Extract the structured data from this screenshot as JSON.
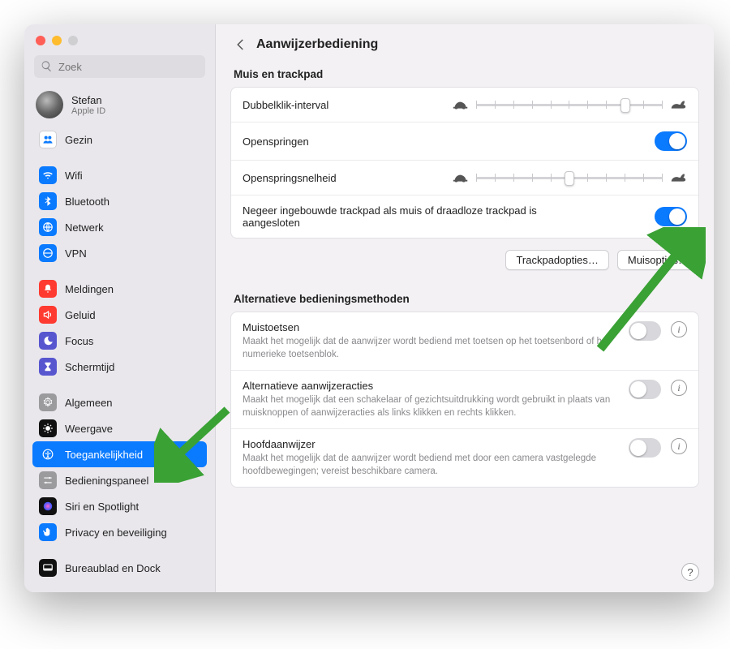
{
  "colors": {
    "accent": "#0a7aff",
    "arrow": "#3aa135"
  },
  "window": {
    "search_placeholder": "Zoek"
  },
  "profile": {
    "name": "Stefan",
    "sub": "Apple ID"
  },
  "sidebar": {
    "items": [
      {
        "label": "Gezin",
        "icon": "family-icon",
        "bg": "#ffffff",
        "fg": "#0a7aff",
        "border": true
      },
      {
        "sep": true
      },
      {
        "label": "Wifi",
        "icon": "wifi-icon",
        "bg": "#0a7aff"
      },
      {
        "label": "Bluetooth",
        "icon": "bluetooth-icon",
        "bg": "#0a7aff"
      },
      {
        "label": "Netwerk",
        "icon": "network-icon",
        "bg": "#0a7aff"
      },
      {
        "label": "VPN",
        "icon": "vpn-icon",
        "bg": "#0a7aff"
      },
      {
        "sep": true
      },
      {
        "label": "Meldingen",
        "icon": "bell-icon",
        "bg": "#ff3a30"
      },
      {
        "label": "Geluid",
        "icon": "sound-icon",
        "bg": "#ff3a30"
      },
      {
        "label": "Focus",
        "icon": "moon-icon",
        "bg": "#5856cf"
      },
      {
        "label": "Schermtijd",
        "icon": "hourglass-icon",
        "bg": "#5856cf"
      },
      {
        "sep": true
      },
      {
        "label": "Algemeen",
        "icon": "gear-icon",
        "bg": "#9b9b9e"
      },
      {
        "label": "Weergave",
        "icon": "display-icon",
        "bg": "#111111"
      },
      {
        "label": "Toegankelijkheid",
        "icon": "accessibility-icon",
        "bg": "#0a7aff",
        "selected": true
      },
      {
        "label": "Bedieningspaneel",
        "icon": "controls-icon",
        "bg": "#9b9b9e"
      },
      {
        "label": "Siri en Spotlight",
        "icon": "siri-icon",
        "bg": "#111111"
      },
      {
        "label": "Privacy en beveiliging",
        "icon": "hand-icon",
        "bg": "#0a7aff"
      },
      {
        "sep": true
      },
      {
        "label": "Bureaublad en Dock",
        "icon": "dock-icon",
        "bg": "#111111"
      }
    ]
  },
  "header": {
    "title": "Aanwijzerbediening"
  },
  "section1": {
    "title": "Muis en trackpad",
    "row_doubleclick": {
      "label": "Dubbelklik-interval",
      "value_percent": 80
    },
    "row_springload": {
      "label": "Openspringen",
      "on": true
    },
    "row_springspeed": {
      "label": "Openspringsnelheid",
      "value_percent": 50
    },
    "row_ignore": {
      "label": "Negeer ingebouwde trackpad als muis of draadloze trackpad is aangesloten",
      "on": true
    },
    "button_trackpad": "Trackpadopties…",
    "button_mouse": "Muisopties…"
  },
  "section2": {
    "title": "Alternatieve bedieningsmethoden",
    "rows": [
      {
        "title": "Muistoetsen",
        "desc": "Maakt het mogelijk dat de aanwijzer wordt bediend met toetsen op het toetsenbord of het numerieke toetsenblok.",
        "on": false
      },
      {
        "title": "Alternatieve aanwijzeracties",
        "desc": "Maakt het mogelijk dat een schakelaar of gezichtsuitdrukking wordt gebruikt in plaats van muisknoppen of aanwijzeracties als links klikken en rechts klikken.",
        "on": false
      },
      {
        "title": "Hoofdaanwijzer",
        "desc": "Maakt het mogelijk dat de aanwijzer wordt bediend met door een camera vastgelegde hoofdbewegingen; vereist beschikbare camera.",
        "on": false
      }
    ]
  },
  "help": "?"
}
